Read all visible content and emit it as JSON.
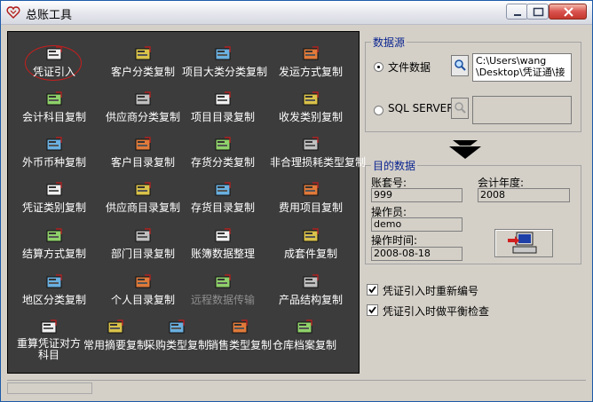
{
  "window": {
    "title": "总账工具"
  },
  "colors": {
    "panel_bg": "#3c3c3c",
    "group_title": "#0a248f",
    "highlight_circle": "#c81e1e"
  },
  "tools": [
    {
      "label": "凭证引入",
      "icon": "voucher-import-icon"
    },
    {
      "label": "客户分类复制",
      "icon": "customer-category-icon"
    },
    {
      "label": "项目大类分类复制",
      "icon": "project-category-icon"
    },
    {
      "label": "发运方式复制",
      "icon": "shipping-method-icon"
    },
    {
      "label": "会计科目复制",
      "icon": "account-subject-icon"
    },
    {
      "label": "供应商分类复制",
      "icon": "supplier-category-icon"
    },
    {
      "label": "项目目录复制",
      "icon": "project-catalog-icon"
    },
    {
      "label": "收发类别复制",
      "icon": "transceive-category-icon"
    },
    {
      "label": "外币币种复制",
      "icon": "foreign-currency-icon"
    },
    {
      "label": "客户目录复制",
      "icon": "customer-catalog-icon"
    },
    {
      "label": "存货分类复制",
      "icon": "inventory-category-icon"
    },
    {
      "label": "非合理损耗类型复制",
      "icon": "loss-type-icon"
    },
    {
      "label": "凭证类别复制",
      "icon": "voucher-category-icon"
    },
    {
      "label": "供应商目录复制",
      "icon": "supplier-catalog-icon"
    },
    {
      "label": "存货目录复制",
      "icon": "inventory-catalog-icon"
    },
    {
      "label": "费用项目复制",
      "icon": "expense-item-icon"
    },
    {
      "label": "结算方式复制",
      "icon": "settlement-method-icon"
    },
    {
      "label": "部门目录复制",
      "icon": "department-catalog-icon"
    },
    {
      "label": "账簿数据整理",
      "icon": "ledger-data-icon"
    },
    {
      "label": "成套件复制",
      "icon": "kit-parts-icon"
    },
    {
      "label": "地区分类复制",
      "icon": "region-category-icon"
    },
    {
      "label": "个人目录复制",
      "icon": "personal-catalog-icon"
    },
    {
      "label": "远程数据传输",
      "icon": "remote-transfer-icon",
      "disabled": true
    },
    {
      "label": "产品结构复制",
      "icon": "product-structure-icon"
    },
    {
      "label": "重算凭证对方科目",
      "icon": "recalc-voucher-icon"
    },
    {
      "label": "常用摘要复制",
      "icon": "common-summary-icon"
    },
    {
      "label": "采购类型复制",
      "icon": "purchase-type-icon"
    },
    {
      "label": "销售类型复制",
      "icon": "sales-type-icon"
    },
    {
      "label": "仓库档案复制",
      "icon": "warehouse-archive-icon"
    }
  ],
  "source": {
    "title": "数据源",
    "file_option": "文件数据",
    "file_path": "C:\\Users\\wang\n\\Desktop\\凭证通\\接",
    "sql_option": "SQL SERVER",
    "sql_path": ""
  },
  "target": {
    "title": "目的数据",
    "account_label": "账套号:",
    "account_value": "999",
    "year_label": "会计年度:",
    "year_value": "2008",
    "operator_label": "操作员:",
    "operator_value": "demo",
    "time_label": "操作时间:",
    "time_value": "2008-08-18"
  },
  "options": {
    "renumber_label": "凭证引入时重新编号",
    "renumber_checked": true,
    "balance_label": "凭证引入时做平衡检查",
    "balance_checked": true
  }
}
